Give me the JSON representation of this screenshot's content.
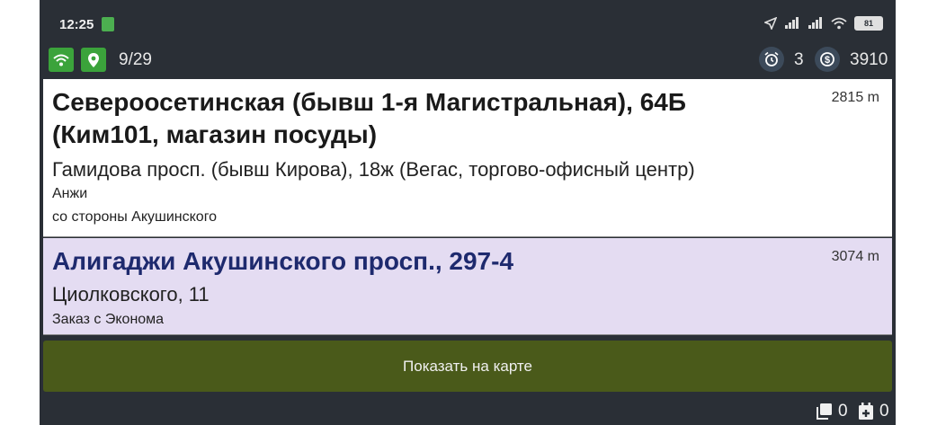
{
  "status_bar": {
    "time": "12:25",
    "battery": "81"
  },
  "top_bar": {
    "order_counter": "9/29",
    "timer_count": "3",
    "balance": "3910"
  },
  "orders": [
    {
      "address": "Североосетинская (бывш 1-я Магистральная), 64Б (Ким101, магазин посуды)",
      "distance": "2815 m",
      "destination": "Гамидова просп. (бывш Кирова), 18ж (Вегас, торгово-офисный центр)",
      "note1": "Анжи",
      "note2": "со стороны Акушинского"
    },
    {
      "address": "Алигаджи Акушинского просп., 297-4",
      "distance": "3074 m",
      "destination": "Циолковского, 11",
      "note1": "Заказ с Эконома"
    }
  ],
  "map_button_label": "Показать на карте",
  "bottom_bar": {
    "copies_count": "0",
    "added_count": "0"
  },
  "colors": {
    "background": "#2a2f36",
    "green_icon": "#3ba33b",
    "selected_card": "#e4dcf2",
    "map_button": "#4a5a1a",
    "selected_address": "#1e2a6e"
  }
}
